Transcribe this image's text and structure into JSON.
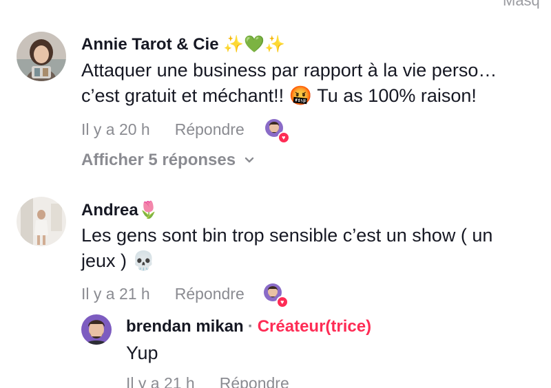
{
  "top_fragment": "Masq",
  "comments": [
    {
      "username": "Annie Tarot & Cie",
      "username_emoji": "✨💚✨",
      "text_line1": "Attaquer une business par rapport à la vie perso…",
      "text_line2": "c’est gratuit et méchant!! 🤬 Tu as 100% raison!",
      "time": "Il y a 20 h",
      "reply_label": "Répondre",
      "view_replies": "Afficher 5 réponses"
    },
    {
      "username": "Andrea",
      "username_emoji": "🌷",
      "text_line1": "Les gens sont bin trop sensible c’est un show ( un",
      "text_line2": "jeux ) 💀",
      "time": "Il y a 21 h",
      "reply_label": "Répondre"
    }
  ],
  "reply": {
    "username": "brendan mikan",
    "separator": "·",
    "creator_label": "Créateur(trice)",
    "text": "Yup",
    "time": "Il y a 21 h",
    "reply_label": "Répondre"
  },
  "colors": {
    "accent": "#fe2c55",
    "meta": "#8a8b91",
    "text": "#161823"
  },
  "icons": {
    "heart": "heart-icon",
    "chevron": "chevron-down-icon"
  }
}
